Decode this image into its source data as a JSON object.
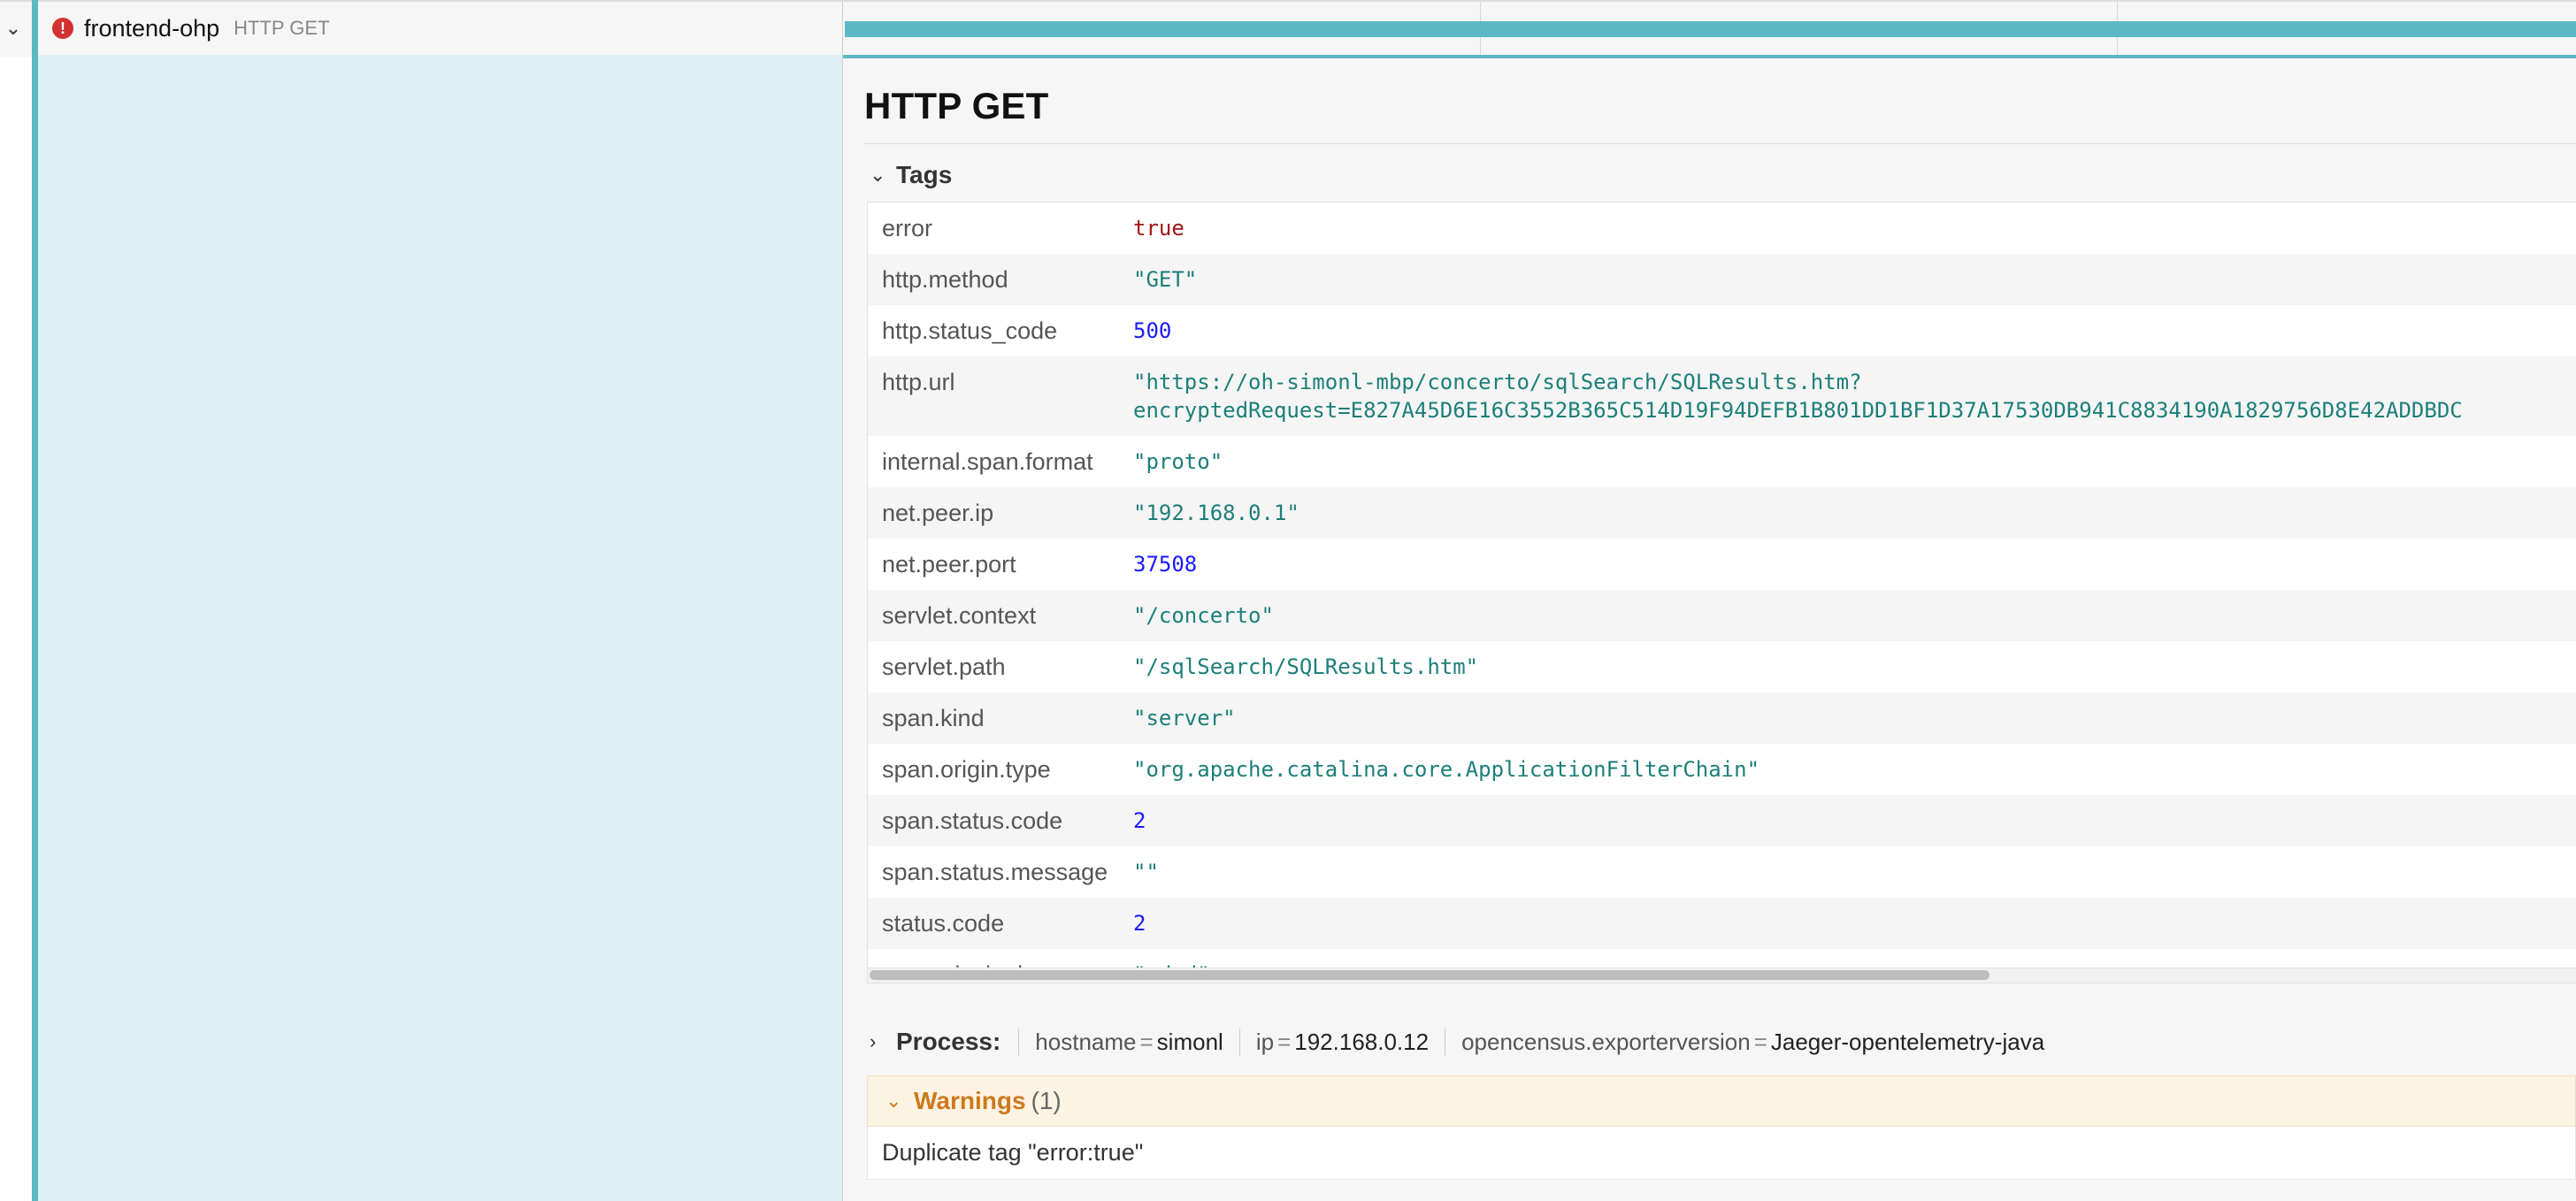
{
  "span": {
    "service": "frontend-ohp",
    "operation": "HTTP GET"
  },
  "detail": {
    "title": "HTTP GET",
    "tags_label": "Tags",
    "tags": [
      {
        "key": "error",
        "value": "true"
      },
      {
        "key": "http.method",
        "value": "\"GET\""
      },
      {
        "key": "http.status_code",
        "value": "500"
      },
      {
        "key": "http.url",
        "value": "\"https://oh-simonl-mbp/concerto/sqlSearch/SQLResults.htm?",
        "value2": "encryptedRequest=E827A45D6E16C3552B365C514D19F94DEFB1B801DD1BF1D37A17530DB941C8834190A1829756D8E42ADDBDC"
      },
      {
        "key": "internal.span.format",
        "value": "\"proto\""
      },
      {
        "key": "net.peer.ip",
        "value": "\"192.168.0.1\""
      },
      {
        "key": "net.peer.port",
        "value": "37508"
      },
      {
        "key": "servlet.context",
        "value": "\"/concerto\""
      },
      {
        "key": "servlet.path",
        "value": "\"/sqlSearch/SQLResults.htm\""
      },
      {
        "key": "span.kind",
        "value": "\"server\""
      },
      {
        "key": "span.origin.type",
        "value": "\"org.apache.catalina.core.ApplicationFilterChain\""
      },
      {
        "key": "span.status.code",
        "value": "2"
      },
      {
        "key": "span.status.message",
        "value": "\"\""
      },
      {
        "key": "status.code",
        "value": "2"
      },
      {
        "key": "user.principal",
        "value": "\"rded\""
      }
    ],
    "process": {
      "label": "Process:",
      "items": [
        {
          "key": "hostname",
          "eq": "=",
          "value": "simonl"
        },
        {
          "key": "ip",
          "eq": "=",
          "value": "192.168.0.12"
        },
        {
          "key": "opencensus.exporterversion",
          "eq": "=",
          "value": "Jaeger-opentelemetry-java"
        }
      ]
    },
    "warnings": {
      "label": "Warnings",
      "count": "(1)",
      "items": [
        "Duplicate tag \"error:true\""
      ]
    }
  },
  "icons": {
    "collapse": "chevron-down-icon",
    "error": "error-circle-icon",
    "tags_toggle": "chevron-down-icon",
    "process_toggle": "chevron-right-icon",
    "warnings_toggle": "chevron-down-icon"
  },
  "colors": {
    "accent": "#5ab9c2",
    "left_panel": "#ddeff2",
    "error": "#d23232",
    "warning": "#cc7a1e",
    "string_value": "#1c7f7a",
    "number_value": "#1a1aff",
    "bool_value": "#a31515"
  }
}
